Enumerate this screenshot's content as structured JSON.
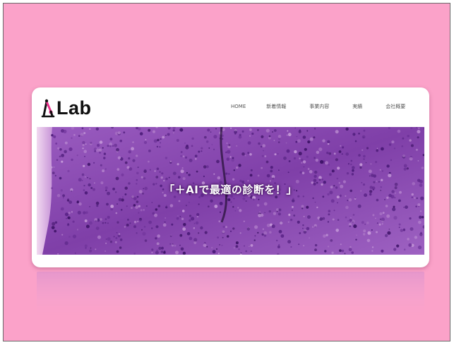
{
  "colors": {
    "background": "#fba2c9",
    "card": "#ffffff",
    "logo_accent": "#e8308a",
    "nav_text": "#555555",
    "hero_tint": "#8f4fb3"
  },
  "header": {
    "logo_text": "Lab",
    "logo_icon": "microscope-icon"
  },
  "nav": {
    "items": [
      {
        "label": "HOME"
      },
      {
        "label": "新着情報"
      },
      {
        "label": "事業内容"
      },
      {
        "label": "実績"
      },
      {
        "label": "会社概要"
      }
    ]
  },
  "hero": {
    "tagline": "「＋AIで最適の診断を！」",
    "image": "histology-micrograph"
  }
}
